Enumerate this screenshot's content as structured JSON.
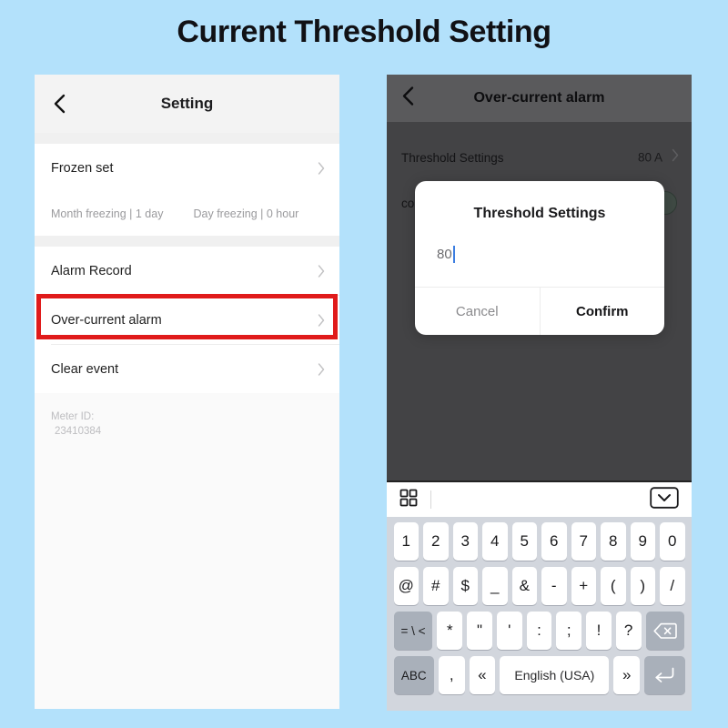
{
  "page": {
    "title": "Current Threshold Setting",
    "background_color": "#b3e1fb",
    "highlight_color": "#e01b1b"
  },
  "left_phone": {
    "nav": {
      "title": "Setting",
      "back_icon": "chevron-left-icon"
    },
    "rows": [
      {
        "label": "Frozen set",
        "chevron": "chevron-right-icon"
      }
    ],
    "freeze_info": {
      "month": "Month freezing | 1 day",
      "day": "Day freezing | 0 hour"
    },
    "list": [
      {
        "label": "Alarm Record",
        "chevron": "chevron-right-icon",
        "highlighted": false
      },
      {
        "label": "Over-current alarm",
        "chevron": "chevron-right-icon",
        "highlighted": true
      },
      {
        "label": "Clear event",
        "chevron": "chevron-right-icon",
        "highlighted": false
      }
    ],
    "meter": {
      "label": "Meter ID:",
      "value": "23410384"
    }
  },
  "right_phone": {
    "nav": {
      "title": "Over-current alarm",
      "back_icon": "chevron-left-icon"
    },
    "rows": [
      {
        "label": "Threshold Settings",
        "value": "80 A",
        "chevron": "chevron-right-icon"
      },
      {
        "label": "co",
        "value": "",
        "toggle": true
      }
    ],
    "dialog": {
      "title": "Threshold Settings",
      "input_value": "80",
      "input_placeholder": "",
      "cancel_label": "Cancel",
      "confirm_label": "Confirm",
      "caret_color": "#3b7de0"
    },
    "keyboard": {
      "toolbar": {
        "left_icon": "grid-squares-icon",
        "right_icon": "hide-keyboard-chevron-icon"
      },
      "rows": [
        {
          "keys": [
            {
              "label": "1",
              "style": "light"
            },
            {
              "label": "2",
              "style": "light"
            },
            {
              "label": "3",
              "style": "light"
            },
            {
              "label": "4",
              "style": "light"
            },
            {
              "label": "5",
              "style": "light"
            },
            {
              "label": "6",
              "style": "light"
            },
            {
              "label": "7",
              "style": "light"
            },
            {
              "label": "8",
              "style": "light"
            },
            {
              "label": "9",
              "style": "light"
            },
            {
              "label": "0",
              "style": "light"
            }
          ]
        },
        {
          "keys": [
            {
              "label": "@",
              "style": "light"
            },
            {
              "label": "#",
              "style": "light"
            },
            {
              "label": "$",
              "style": "light"
            },
            {
              "label": "_",
              "style": "light"
            },
            {
              "label": "&",
              "style": "light"
            },
            {
              "label": "-",
              "style": "light"
            },
            {
              "label": "+",
              "style": "light"
            },
            {
              "label": "(",
              "style": "light"
            },
            {
              "label": ")",
              "style": "light"
            },
            {
              "label": "/",
              "style": "light"
            }
          ]
        },
        {
          "keys": [
            {
              "label": "= \\ <",
              "style": "dark",
              "name": "symbols-toggle-key"
            },
            {
              "label": "*",
              "style": "light"
            },
            {
              "label": "\"",
              "style": "light"
            },
            {
              "label": "'",
              "style": "light"
            },
            {
              "label": ":",
              "style": "light"
            },
            {
              "label": ";",
              "style": "light"
            },
            {
              "label": "!",
              "style": "light"
            },
            {
              "label": "?",
              "style": "light"
            },
            {
              "label": "",
              "style": "dark",
              "name": "backspace-key",
              "icon": "backspace-icon"
            }
          ]
        },
        {
          "keys": [
            {
              "label": "ABC",
              "style": "dark",
              "name": "abc-key"
            },
            {
              "label": ",",
              "style": "light"
            },
            {
              "label": "«",
              "style": "light",
              "name": "prev-key"
            },
            {
              "label": "English (USA)",
              "style": "light",
              "name": "space-key"
            },
            {
              "label": "»",
              "style": "light",
              "name": "next-key"
            },
            {
              "label": "",
              "style": "dark",
              "name": "enter-key",
              "icon": "enter-icon"
            }
          ]
        }
      ]
    }
  }
}
